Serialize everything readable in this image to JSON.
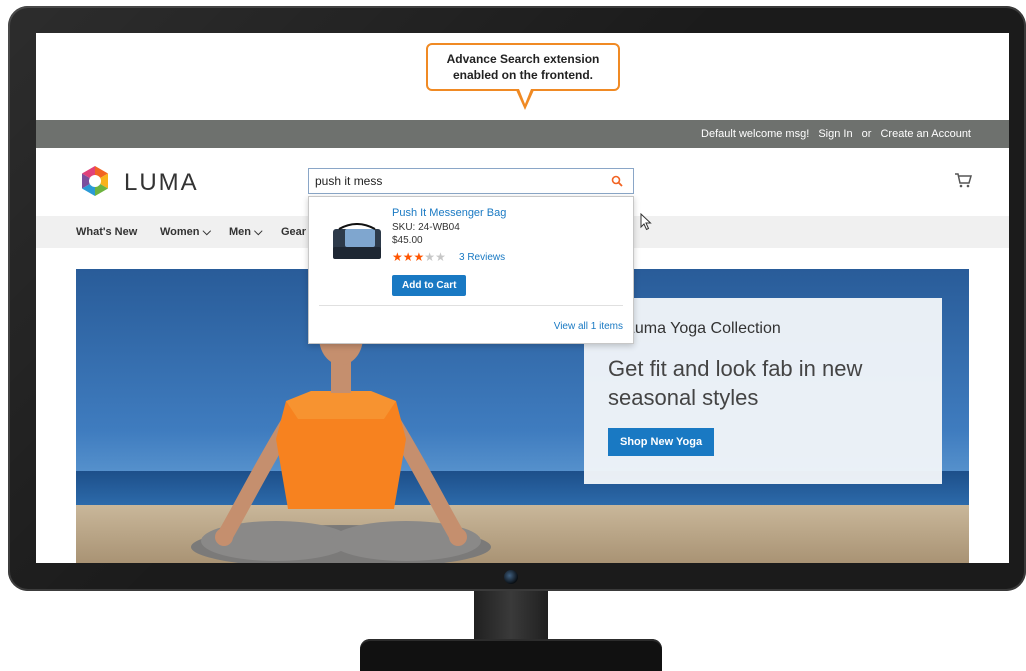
{
  "callout": {
    "line1": "Advance Search extension",
    "line2": "enabled on the frontend."
  },
  "topbar": {
    "welcome": "Default welcome msg!",
    "sign_in": "Sign In",
    "or": "or",
    "create_account": "Create an Account"
  },
  "header": {
    "logo": "LUMA",
    "search_value": "push it mess",
    "icons": [
      "search-icon",
      "cart-icon"
    ]
  },
  "nav": {
    "items": [
      "What's New",
      "Women",
      "Men",
      "Gear"
    ]
  },
  "dropdown": {
    "product_name": "Push It Messenger Bag",
    "sku": "SKU: 24-WB04",
    "price": "$45.00",
    "rating_stars": 3,
    "rating_max": 5,
    "reviews": "3 Reviews",
    "add_to_cart": "Add to Cart",
    "view_all": "View all 1 items"
  },
  "hero": {
    "subtitle": "w Luma Yoga Collection",
    "title": "Get fit and look fab in new seasonal styles",
    "button": "Shop New Yoga"
  },
  "colors": {
    "accent": "#1979c3",
    "callout_border": "#f08a24",
    "topbar": "#6e716e",
    "stars": "#ff5501"
  }
}
